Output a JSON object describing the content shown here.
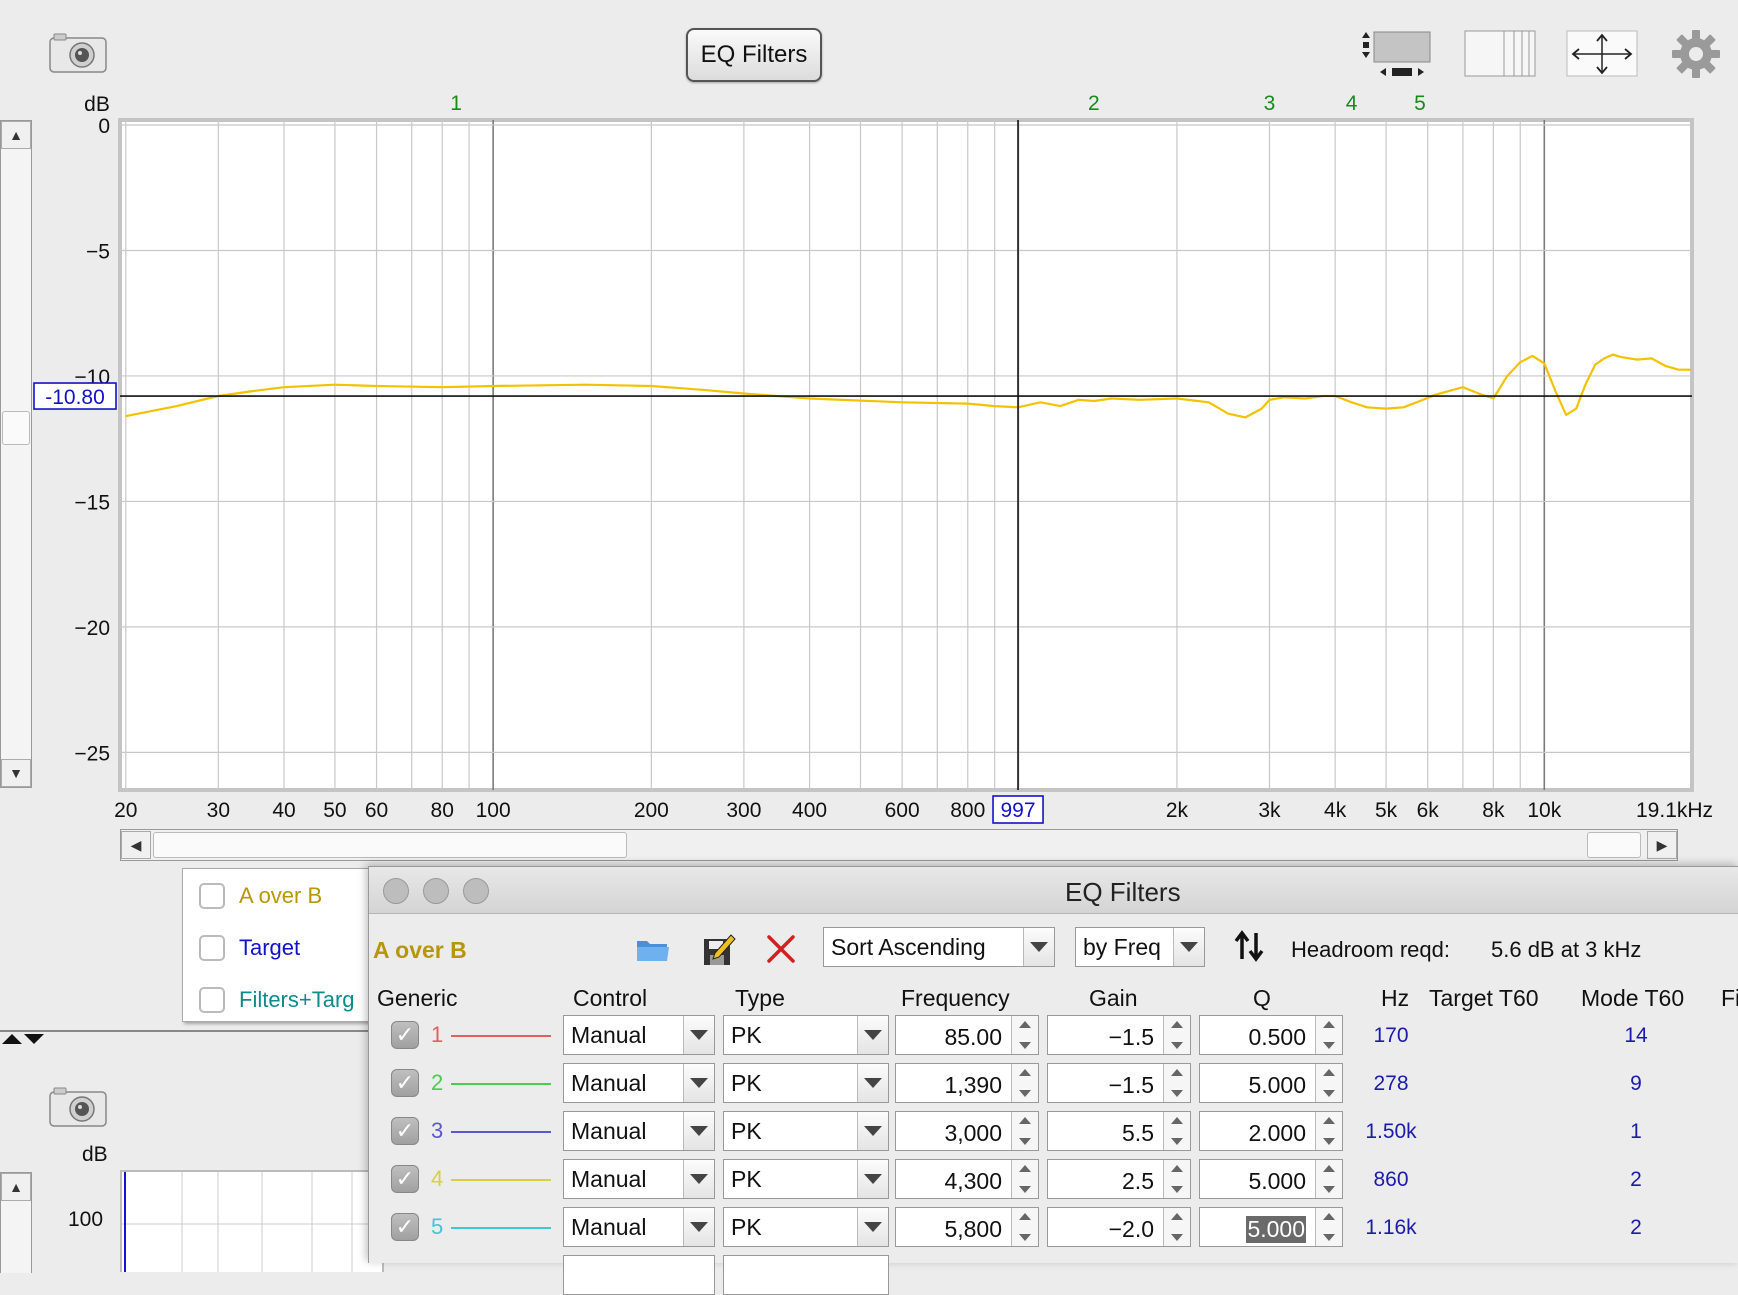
{
  "toolbar": {
    "eq_filters_button": "EQ Filters"
  },
  "chart": {
    "y_unit": "dB",
    "cursor_y_value": "-10.80",
    "cursor_x_value": "997",
    "x_unit_label": "19.1kHz",
    "marker_labels": [
      "1",
      "2",
      "3",
      "4",
      "5"
    ],
    "marker_color": "#1a8a1a",
    "trace_color": "#f2c200"
  },
  "chart_data": {
    "type": "line",
    "xlabel": "",
    "ylabel": "dB",
    "x_scale": "log",
    "xlim": [
      19.5,
      19100
    ],
    "ylim": [
      -26.5,
      0.2
    ],
    "x_ticks": [
      20,
      30,
      40,
      50,
      60,
      80,
      100,
      200,
      300,
      400,
      600,
      800,
      2000,
      3000,
      4000,
      5000,
      6000,
      8000,
      10000
    ],
    "x_tick_labels": [
      "20",
      "30",
      "40",
      "50",
      "60",
      "80",
      "100",
      "200",
      "300",
      "400",
      "600",
      "800",
      "2k",
      "3k",
      "4k",
      "5k",
      "6k",
      "8k",
      "10k"
    ],
    "y_ticks": [
      0,
      -5,
      -10,
      -15,
      -20,
      -25
    ],
    "y_tick_labels": [
      "0",
      "−5",
      "−10",
      "−15",
      "−20",
      "−25"
    ],
    "grid": true,
    "marker_freqs": [
      85,
      1390,
      3000,
      4300,
      5800
    ],
    "cursor": {
      "x": 997,
      "y": -10.8
    },
    "series": [
      {
        "x": [
          20,
          25,
          30,
          35,
          40,
          50,
          60,
          80,
          100,
          150,
          200,
          250,
          300,
          400,
          600,
          800,
          900,
          997,
          1100,
          1200,
          1300,
          1390,
          1500,
          1700,
          2000,
          2300,
          2500,
          2700,
          2900,
          3000,
          3200,
          3500,
          3800,
          4000,
          4300,
          4600,
          5000,
          5400,
          5800,
          6200,
          7000,
          7500,
          8000,
          8500,
          9000,
          9500,
          10000,
          10500,
          11000,
          11500,
          12000,
          12500,
          13000,
          13500,
          14000,
          15000,
          16000,
          17000,
          18000,
          19100
        ],
        "y": [
          -11.6,
          -11.2,
          -10.8,
          -10.6,
          -10.45,
          -10.35,
          -10.4,
          -10.45,
          -10.4,
          -10.35,
          -10.4,
          -10.55,
          -10.7,
          -10.9,
          -11.05,
          -11.1,
          -11.2,
          -11.25,
          -11.05,
          -11.2,
          -10.95,
          -11.0,
          -10.9,
          -10.95,
          -10.9,
          -11.05,
          -11.5,
          -11.65,
          -11.3,
          -10.95,
          -10.85,
          -10.9,
          -10.8,
          -10.8,
          -11.05,
          -11.25,
          -11.3,
          -11.25,
          -11.0,
          -10.75,
          -10.45,
          -10.7,
          -10.9,
          -10.0,
          -9.45,
          -9.2,
          -9.5,
          -10.6,
          -11.55,
          -11.3,
          -10.3,
          -9.55,
          -9.3,
          -9.15,
          -9.25,
          -9.35,
          -9.3,
          -9.6,
          -9.75,
          -9.75
        ]
      }
    ]
  },
  "legend": {
    "items": [
      {
        "label": "A over B",
        "color": "#b8960b"
      },
      {
        "label": "Target",
        "color": "#1212c8"
      },
      {
        "label": "Filters+Targ",
        "color": "#0f8a8a"
      }
    ]
  },
  "lower_chart": {
    "y_unit": "dB",
    "first_tick": "100"
  },
  "dialog": {
    "title": "EQ Filters",
    "measurement": "A over B",
    "measurement_color": "#b8960b",
    "sort_order": "Sort Ascending",
    "sort_by": "by Freq",
    "headroom_label": "Headroom reqd:",
    "headroom_value": "5.6 dB at 3 kHz",
    "columns": [
      "Generic",
      "Control",
      "Type",
      "Frequency",
      "Gain",
      "Q",
      "Hz",
      "Target T60",
      "Mode T60",
      "Fi"
    ],
    "filters": [
      {
        "num": "1",
        "color": "#e06060",
        "control": "Manual",
        "type": "PK",
        "frequency": "85.00",
        "gain": "−1.5",
        "q": "0.500",
        "hz": "170",
        "mode_t60": "14"
      },
      {
        "num": "2",
        "color": "#4ccc4c",
        "control": "Manual",
        "type": "PK",
        "frequency": "1,390",
        "gain": "−1.5",
        "q": "5.000",
        "hz": "278",
        "mode_t60": "9"
      },
      {
        "num": "3",
        "color": "#5858d0",
        "control": "Manual",
        "type": "PK",
        "frequency": "3,000",
        "gain": "5.5",
        "q": "2.000",
        "hz": "1.50k",
        "mode_t60": "1"
      },
      {
        "num": "4",
        "color": "#d8d040",
        "control": "Manual",
        "type": "PK",
        "frequency": "4,300",
        "gain": "2.5",
        "q": "5.000",
        "hz": "860",
        "mode_t60": "2"
      },
      {
        "num": "5",
        "color": "#40c8d0",
        "control": "Manual",
        "type": "PK",
        "frequency": "5,800",
        "gain": "−2.0",
        "q": "5.000",
        "hz": "1.16k",
        "mode_t60": "2"
      }
    ]
  }
}
